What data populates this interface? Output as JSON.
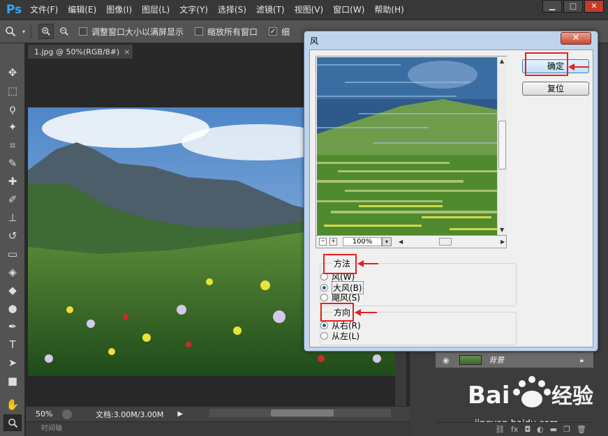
{
  "app": {
    "logo": "Ps"
  },
  "menu": [
    "文件(F)",
    "编辑(E)",
    "图像(I)",
    "图层(L)",
    "文字(Y)",
    "选择(S)",
    "滤镜(T)",
    "视图(V)",
    "窗口(W)",
    "帮助(H)"
  ],
  "window_controls": {
    "minimize": "▁",
    "maximize": "□",
    "close": "✕"
  },
  "options_bar": {
    "resize_windows_label": "调整窗口大小以满屏显示",
    "zoom_all_windows_label": "缩放所有窗口",
    "zoom_all_checked": false,
    "resize_checked": false,
    "scrubby_label": "细",
    "scrubby_checked": true
  },
  "document": {
    "tab_title": "1.jpg @ 50%(RGB/8#)",
    "close_glyph": "×"
  },
  "status": {
    "zoom": "50%",
    "doc_info": "文档:3.00M/3.00M"
  },
  "timeline": {
    "label": "时间轴"
  },
  "layers": {
    "layer_name": "背景"
  },
  "watermark": {
    "url": "jingyan.baidu.com"
  },
  "dialog": {
    "title": "风",
    "close_glyph": "✕",
    "ok_label": "确定",
    "reset_label": "复位",
    "zoom_value": "100%",
    "zoom_minus": "−",
    "zoom_plus": "+",
    "method": {
      "title": "方法",
      "options": [
        {
          "label": "风(W)",
          "selected": false
        },
        {
          "label": "大风(B)",
          "selected": true
        },
        {
          "label": "飓风(S)",
          "selected": false
        }
      ]
    },
    "direction": {
      "title": "方向",
      "options": [
        {
          "label": "从右(R)",
          "selected": true
        },
        {
          "label": "从左(L)",
          "selected": false
        }
      ]
    }
  },
  "colors": {
    "accent_red": "#e62020",
    "ps_blue": "#31a8ff"
  }
}
